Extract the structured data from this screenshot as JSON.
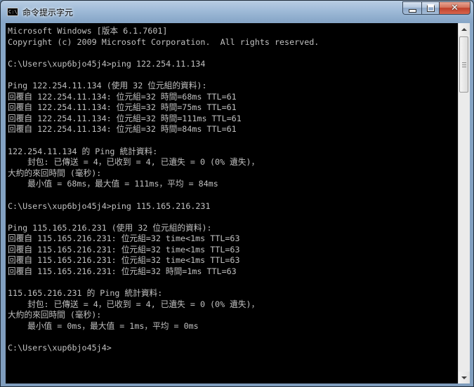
{
  "window": {
    "title": "命令提示字元",
    "icon_label": "C:\\",
    "controls": {
      "minimize_icon": "minimize-icon",
      "maximize_icon": "maximize-icon",
      "close_icon": "close-icon"
    }
  },
  "console": {
    "lines": [
      "Microsoft Windows [版本 6.1.7601]",
      "Copyright (c) 2009 Microsoft Corporation.  All rights reserved.",
      "",
      "C:\\Users\\xup6bjo45j4>ping 122.254.11.134",
      "",
      "Ping 122.254.11.134 (使用 32 位元組的資料):",
      "回覆自 122.254.11.134: 位元組=32 時間=68ms TTL=61",
      "回覆自 122.254.11.134: 位元組=32 時間=75ms TTL=61",
      "回覆自 122.254.11.134: 位元組=32 時間=111ms TTL=61",
      "回覆自 122.254.11.134: 位元組=32 時間=84ms TTL=61",
      "",
      "122.254.11.134 的 Ping 統計資料:",
      "    封包: 已傳送 = 4，已收到 = 4, 已遺失 = 0 (0% 遺失)，",
      "大約的來回時間 (毫秒):",
      "    最小值 = 68ms，最大值 = 111ms，平均 = 84ms",
      "",
      "C:\\Users\\xup6bjo45j4>ping 115.165.216.231",
      "",
      "Ping 115.165.216.231 (使用 32 位元組的資料):",
      "回覆自 115.165.216.231: 位元組=32 time<1ms TTL=63",
      "回覆自 115.165.216.231: 位元組=32 time<1ms TTL=63",
      "回覆自 115.165.216.231: 位元組=32 time<1ms TTL=63",
      "回覆自 115.165.216.231: 位元組=32 時間=1ms TTL=63",
      "",
      "115.165.216.231 的 Ping 統計資料:",
      "    封包: 已傳送 = 4，已收到 = 4, 已遺失 = 0 (0% 遺失)，",
      "大約的來回時間 (毫秒):",
      "    最小值 = 0ms，最大值 = 1ms，平均 = 0ms",
      "",
      "C:\\Users\\xup6bjo45j4>"
    ]
  },
  "scrollbar": {
    "up_icon": "scroll-up-arrow-icon",
    "down_icon": "scroll-down-arrow-icon"
  },
  "colors": {
    "console_background": "#000000",
    "console_text": "#c0c0c0",
    "close_button": "#c0402a"
  }
}
